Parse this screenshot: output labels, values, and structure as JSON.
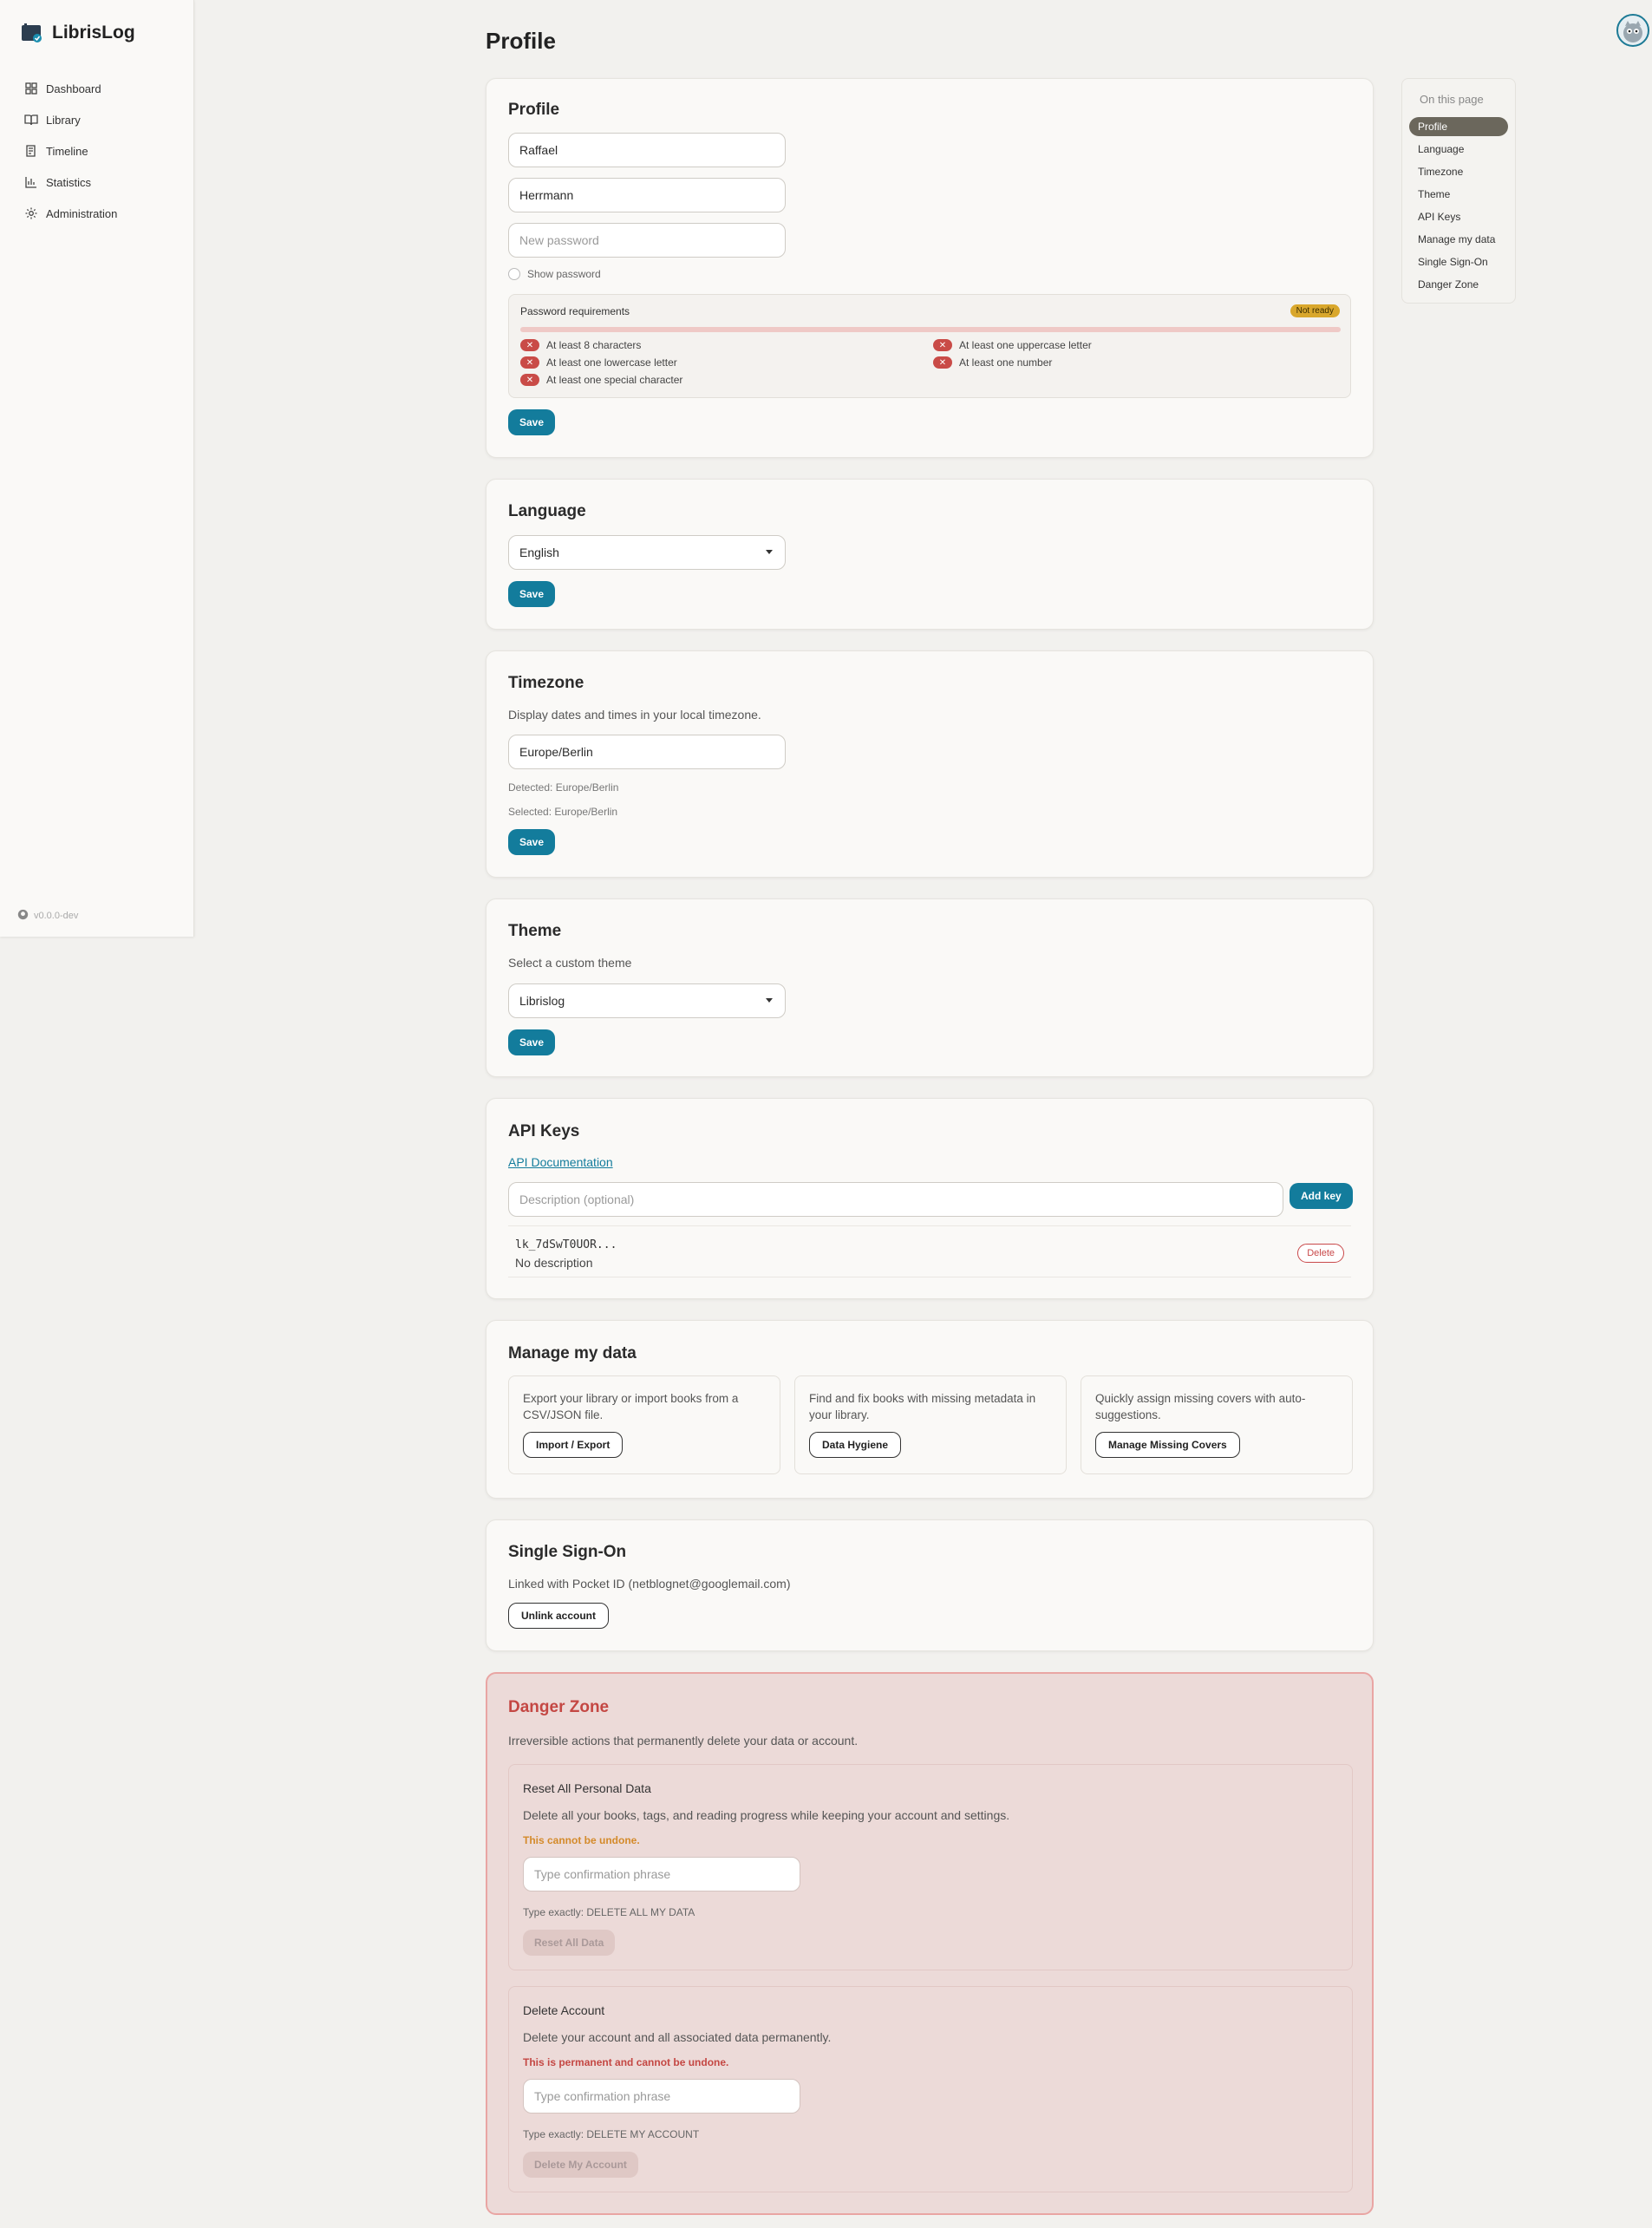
{
  "app": {
    "name": "LibrisLog",
    "version": "v0.0.0-dev"
  },
  "nav": [
    {
      "label": "Dashboard",
      "icon": "dashboard-icon"
    },
    {
      "label": "Library",
      "icon": "book-icon"
    },
    {
      "label": "Timeline",
      "icon": "timeline-icon"
    },
    {
      "label": "Statistics",
      "icon": "chart-icon"
    },
    {
      "label": "Administration",
      "icon": "gear-icon"
    }
  ],
  "page": {
    "title": "Profile"
  },
  "profile": {
    "title": "Profile",
    "first_name": "Raffael",
    "last_name": "Herrmann",
    "password_placeholder": "New password",
    "show_password": "Show password",
    "requirements_title": "Password requirements",
    "status": "Not ready",
    "requirements": [
      "At least 8 characters",
      "At least one uppercase letter",
      "At least one lowercase letter",
      "At least one number",
      "At least one special character"
    ],
    "save": "Save"
  },
  "language": {
    "title": "Language",
    "value": "English",
    "save": "Save"
  },
  "timezone": {
    "title": "Timezone",
    "description": "Display dates and times in your local timezone.",
    "value": "Europe/Berlin",
    "detected": "Detected: Europe/Berlin",
    "selected": "Selected: Europe/Berlin",
    "save": "Save"
  },
  "theme": {
    "title": "Theme",
    "description": "Select a custom theme",
    "value": "Librislog",
    "save": "Save"
  },
  "api_keys": {
    "title": "API Keys",
    "doc_link": "API Documentation",
    "placeholder": "Description (optional)",
    "add": "Add key",
    "keys": [
      {
        "code": "lk_7dSwT0UOR...",
        "description": "No description",
        "delete": "Delete"
      }
    ]
  },
  "manage": {
    "title": "Manage my data",
    "cards": [
      {
        "text": "Export your library or import books from a CSV/JSON file.",
        "button": "Import / Export"
      },
      {
        "text": "Find and fix books with missing metadata in your library.",
        "button": "Data Hygiene"
      },
      {
        "text": "Quickly assign missing covers with auto-suggestions.",
        "button": "Manage Missing Covers"
      }
    ]
  },
  "sso": {
    "title": "Single Sign-On",
    "linked": "Linked with Pocket ID (netblognet@googlemail.com)",
    "unlink": "Unlink account"
  },
  "danger": {
    "title": "Danger Zone",
    "description": "Irreversible actions that permanently delete your data or account.",
    "reset": {
      "title": "Reset All Personal Data",
      "description": "Delete all your books, tags, and reading progress while keeping your account and settings.",
      "warning": "This cannot be undone.",
      "placeholder": "Type confirmation phrase",
      "hint": "Type exactly: DELETE ALL MY DATA",
      "button": "Reset All Data"
    },
    "delete": {
      "title": "Delete Account",
      "description": "Delete your account and all associated data permanently.",
      "warning": "This is permanent and cannot be undone.",
      "placeholder": "Type confirmation phrase",
      "hint": "Type exactly: DELETE MY ACCOUNT",
      "button": "Delete My Account"
    }
  },
  "toc": {
    "heading": "On this page",
    "items": [
      "Profile",
      "Language",
      "Timezone",
      "Theme",
      "API Keys",
      "Manage my data",
      "Single Sign-On",
      "Danger Zone"
    ],
    "active": "Profile"
  },
  "colors": {
    "accent": "#137c9c",
    "danger": "#c44743",
    "warning": "#d9a72c"
  }
}
